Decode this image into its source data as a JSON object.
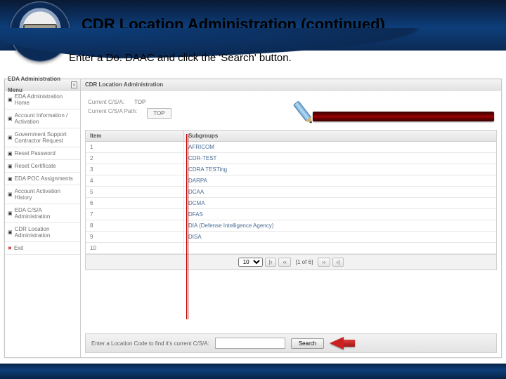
{
  "slide": {
    "title": "CDR Location Administration (continued)",
    "subtitle": "Enter a Do. DAAC and click the 'Search' button.",
    "page_number": ""
  },
  "sidebar": {
    "header": "EDA Administration Menu",
    "collapse_glyph": "‹",
    "items": [
      {
        "label": "EDA Administration Home"
      },
      {
        "label": "Account Information / Activation"
      },
      {
        "label": "Government Support Contractor Request"
      },
      {
        "label": "Reset Password"
      },
      {
        "label": "Reset Certificate"
      },
      {
        "label": "EDA POC Assignments"
      },
      {
        "label": "Account Activation History"
      },
      {
        "label": "EDA C/S/A Administration"
      },
      {
        "label": "CDR Location Administration"
      }
    ],
    "exit_label": "Exit"
  },
  "main": {
    "breadcrumb": "CDR Location Administration",
    "current_csa_label": "Current C/S/A:",
    "current_csa_value": "TOP",
    "current_path_label": "Current C/S/A Path:",
    "current_path_value": "TOP",
    "table_headers": {
      "item": "Item",
      "subgroups": "Subgroups"
    },
    "rows": [
      {
        "n": "1",
        "name": "AFRICOM"
      },
      {
        "n": "2",
        "name": "CDR-TEST"
      },
      {
        "n": "3",
        "name": "CDRA TESTing"
      },
      {
        "n": "4",
        "name": "DARPA"
      },
      {
        "n": "5",
        "name": "DCAA"
      },
      {
        "n": "6",
        "name": "DCMA"
      },
      {
        "n": "7",
        "name": "DFAS"
      },
      {
        "n": "8",
        "name": "DIA (Defense Intelligence Agency)"
      },
      {
        "n": "9",
        "name": "DISA"
      },
      {
        "n": "10",
        "name": ""
      }
    ],
    "pager": {
      "page_size": "10",
      "first": "|‹",
      "prev": "‹‹",
      "status": "[1 of 6]",
      "next": "››",
      "last": "›|"
    },
    "search": {
      "prompt": "Enter a Location Code to find it's current C/S/A:",
      "placeholder": "",
      "button": "Search"
    }
  }
}
